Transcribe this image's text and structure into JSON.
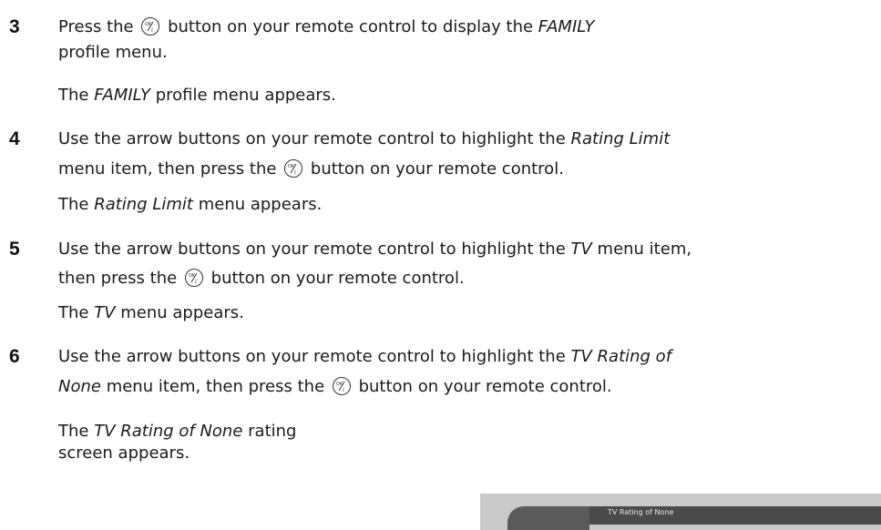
{
  "steps": [
    {
      "number": "3",
      "line1_before": "Press the ",
      "line1_after": " button on your remote control to display the ",
      "line1_italic": "FAMILY",
      "line2": "profile menu.",
      "result_italic": "FAMILY",
      "result_after": " profile menu appears."
    },
    {
      "number": "4",
      "line1_before": "Use the arrow buttons on your remote control to highlight the ",
      "line1_italic": "Rating Limit",
      "line2_before": "menu item, then press the ",
      "line2_after": " button on your remote control.",
      "result_before": "The ",
      "result_italic": "Rating Limit",
      "result_after": " menu appears."
    },
    {
      "number": "5",
      "line1_before": "Use the arrow buttons on your remote control to highlight the ",
      "line1_italic": "TV",
      "line1_after": " menu item,",
      "line2_before": "then press the ",
      "line2_after": " button on your remote control.",
      "result_before": "The ",
      "result_italic": "TV",
      "result_after": " menu appears."
    },
    {
      "number": "6",
      "line1_before": "Use the arrow buttons on your remote control to highlight the ",
      "line1_italic": "TV Rating of",
      "line2_italic": "None",
      "line2_before": " menu item, then press the ",
      "line2_after": " button on your remote control.",
      "result_before": "The ",
      "result_italic": "TV Rating of None",
      "result_after": " rating",
      "result_line2": "screen appears."
    }
  ],
  "the_word": "The ",
  "ok_icon": "ok-button-icon",
  "screen": {
    "title": "TV Rating of None"
  }
}
